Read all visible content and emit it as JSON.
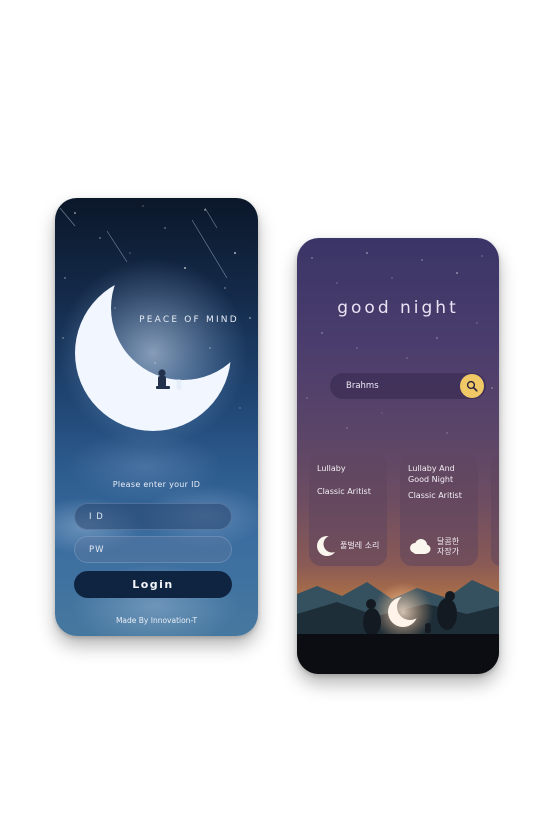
{
  "login_screen": {
    "tagline": "PEACE OF MIND",
    "prompt": "Please enter your ID",
    "id_placeholder": "I D",
    "pw_placeholder": "PW",
    "login_label": "Login",
    "credit": "Made By Innovation-T"
  },
  "music_screen": {
    "title": "good night",
    "search_value": "Brahms",
    "cards": [
      {
        "title": "Lullaby",
        "subtitle": "Classic Aritist",
        "footer": "풀벌레 소리",
        "icon": "crescent-moon-icon"
      },
      {
        "title": "Lullaby And Good Night",
        "subtitle": "Classic Aritist",
        "footer": "달콤한 자장가",
        "icon": "cloud-icon"
      }
    ]
  },
  "colors": {
    "login_bg_top": "#0b1729",
    "login_bg_bottom": "#46789f",
    "login_button": "#0f2440",
    "night_bg_top": "#3a3567",
    "night_bg_bottom": "#e39a3a",
    "search_accent": "#f0c865"
  }
}
